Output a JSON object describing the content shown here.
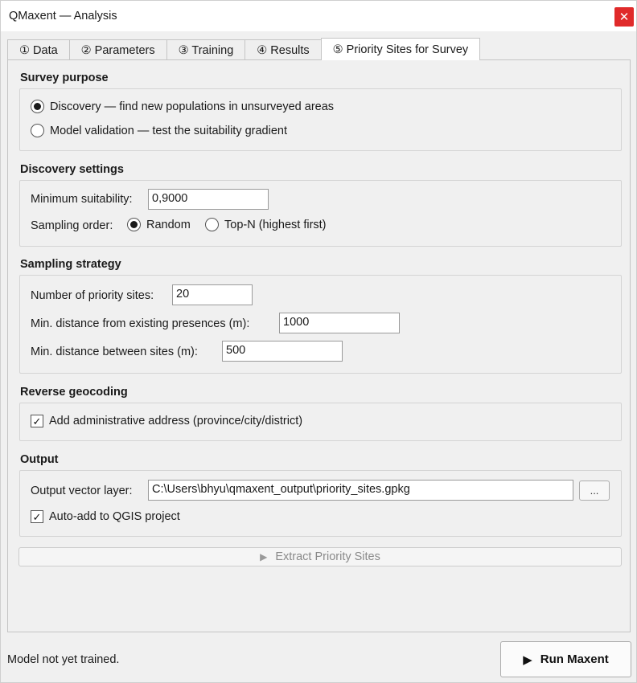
{
  "window": {
    "title": "QMaxent — Analysis",
    "close_glyph": "✕"
  },
  "tabs": [
    {
      "label": "① Data",
      "active": false
    },
    {
      "label": "② Parameters",
      "active": false
    },
    {
      "label": "③ Training",
      "active": false
    },
    {
      "label": "④ Results",
      "active": false
    },
    {
      "label": "⑤ Priority Sites for Survey",
      "active": true
    }
  ],
  "survey_purpose": {
    "title": "Survey purpose",
    "options": [
      {
        "label": "Discovery — find new populations in unsurveyed areas",
        "checked": true
      },
      {
        "label": "Model validation — test the suitability gradient",
        "checked": false
      }
    ]
  },
  "discovery_settings": {
    "title": "Discovery settings",
    "min_suitability_label": "Minimum suitability:",
    "min_suitability_value": "0,9000",
    "sampling_order_label": "Sampling order:",
    "sampling_order_options": [
      {
        "label": "Random",
        "checked": true
      },
      {
        "label": "Top-N (highest first)",
        "checked": false
      }
    ]
  },
  "sampling_strategy": {
    "title": "Sampling strategy",
    "num_sites_label": "Number of priority sites:",
    "num_sites_value": "20",
    "min_dist_presences_label": "Min. distance from existing presences (m):",
    "min_dist_presences_value": "1000",
    "min_dist_sites_label": "Min. distance between sites (m):",
    "min_dist_sites_value": "500"
  },
  "reverse_geocoding": {
    "title": "Reverse geocoding",
    "add_address_label": "Add administrative address (province/city/district)",
    "add_address_checked": true
  },
  "output": {
    "title": "Output",
    "vector_layer_label": "Output vector layer:",
    "vector_layer_value": "C:\\Users\\bhyu\\qmaxent_output\\priority_sites.gpkg",
    "browse_label": "...",
    "auto_add_label": "Auto-add to QGIS project",
    "auto_add_checked": true
  },
  "extract_button": {
    "label": "Extract Priority Sites",
    "enabled": false
  },
  "status": {
    "text": "Model not yet trained."
  },
  "run_button": {
    "label": "Run Maxent"
  },
  "glyphs": {
    "check": "✓",
    "play": "▶"
  }
}
